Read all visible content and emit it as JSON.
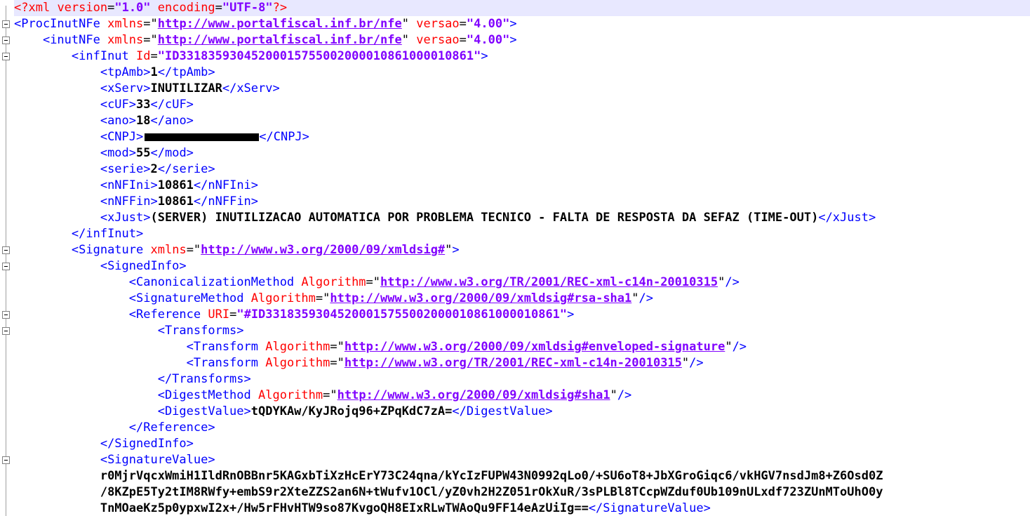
{
  "xml_decl": {
    "open": "<?xml",
    "attr1": "version",
    "val1": "\"1.0\"",
    "attr2": "encoding",
    "val2": "\"UTF-8\"",
    "close": "?>"
  },
  "proc": {
    "open": "<ProcInutNFe",
    "xmlns_attr": "xmlns",
    "xmlns_val": "http://www.portalfiscal.inf.br/nfe",
    "versao_attr": "versao",
    "versao_val": "\"4.00\"",
    "end": ">"
  },
  "inut": {
    "open": "<inutNFe",
    "xmlns_attr": "xmlns",
    "xmlns_val": "http://www.portalfiscal.inf.br/nfe",
    "versao_attr": "versao",
    "versao_val": "\"4.00\"",
    "end": ">"
  },
  "infinut": {
    "open": "<infInut",
    "id_attr": "Id",
    "id_val": "\"ID3318359304520001575500200001086100001086​1\"",
    "end": ">",
    "close": "</infInut>"
  },
  "fields": {
    "tpAmb": {
      "open": "<tpAmb>",
      "value": "1",
      "close": "</tpAmb>"
    },
    "xServ": {
      "open": "<xServ>",
      "value": "INUTILIZAR",
      "close": "</xServ>"
    },
    "cUF": {
      "open": "<cUF>",
      "value": "33",
      "close": "</cUF>"
    },
    "ano": {
      "open": "<ano>",
      "value": "18",
      "close": "</ano>"
    },
    "CNPJ": {
      "open": "<CNPJ>",
      "value": "",
      "close": "</CNPJ>"
    },
    "mod": {
      "open": "<mod>",
      "value": "55",
      "close": "</mod>"
    },
    "serie": {
      "open": "<serie>",
      "value": "2",
      "close": "</serie>"
    },
    "nNFIni": {
      "open": "<nNFIni>",
      "value": "10861",
      "close": "</nNFIni>"
    },
    "nNFFin": {
      "open": "<nNFFin>",
      "value": "10861",
      "close": "</nNFFin>"
    },
    "xJust": {
      "open": "<xJust>",
      "value": "(SERVER) INUTILIZACAO AUTOMATICA POR PROBLEMA TECNICO - FALTA DE RESPOSTA DA SEFAZ (TIME-OUT)",
      "close": "</xJust>"
    }
  },
  "signature": {
    "open": "<Signature",
    "xmlns_attr": "xmlns",
    "xmlns_val": "http://www.w3.org/2000/09/xmldsig#",
    "end": ">"
  },
  "signedinfo": {
    "open": "<SignedInfo>",
    "close": "</SignedInfo>"
  },
  "canon": {
    "open": "<CanonicalizationMethod",
    "attr": "Algorithm",
    "val": "http://www.w3.org/TR/2001/REC-xml-c14n-20010315",
    "end": "/>"
  },
  "sigmethod": {
    "open": "<SignatureMethod",
    "attr": "Algorithm",
    "val": "http://www.w3.org/2000/09/xmldsig#rsa-sha1",
    "end": "/>"
  },
  "reference": {
    "open": "<Reference",
    "attr": "URI",
    "val": "\"#ID33183593045200015755002000010861000010861\"",
    "end": ">",
    "close": "</Reference>"
  },
  "transforms": {
    "open": "<Transforms>",
    "close": "</Transforms>"
  },
  "transform1": {
    "open": "<Transform",
    "attr": "Algorithm",
    "val": "http://www.w3.org/2000/09/xmldsig#enveloped-signature",
    "end": "/>"
  },
  "transform2": {
    "open": "<Transform",
    "attr": "Algorithm",
    "val": "http://www.w3.org/TR/2001/REC-xml-c14n-20010315",
    "end": "/>"
  },
  "digestmethod": {
    "open": "<DigestMethod",
    "attr": "Algorithm",
    "val": "http://www.w3.org/2000/09/xmldsig#sha1",
    "end": "/>"
  },
  "digestvalue": {
    "open": "<DigestValue>",
    "value": "tQDYKAw/KyJRojq96+ZPqKdC7zA=",
    "close": "</DigestValue>"
  },
  "sigvalue": {
    "open": "<SignatureValue>",
    "line1": "r0MjrVqcxWmiH1IldRnOBBnr5KAGxbTiXzHcErY73C24qna/kYcIzFUPW43N0992qLo0/+SU6oT8+JbXGroGiqc6/vkHGV7nsdJm8+Z6Osd0Z",
    "line2": "/8KZpE5Ty2tIM8RWfy+embS9r2XteZZS2an6N+tWufv1OCl/yZ0vh2H2Z051rOkXuR/3sPLBl8TCcpWZduf0Ub109nULxdf723ZUnMToUhO0y",
    "line3": "TnMOaeKz5p0ypxwI2x+/Hw5rFHvHTW9so87KvgoQH8EIxRLwTWAoQu9FF14eAzUiIg==",
    "close": "</SignatureValue>"
  }
}
